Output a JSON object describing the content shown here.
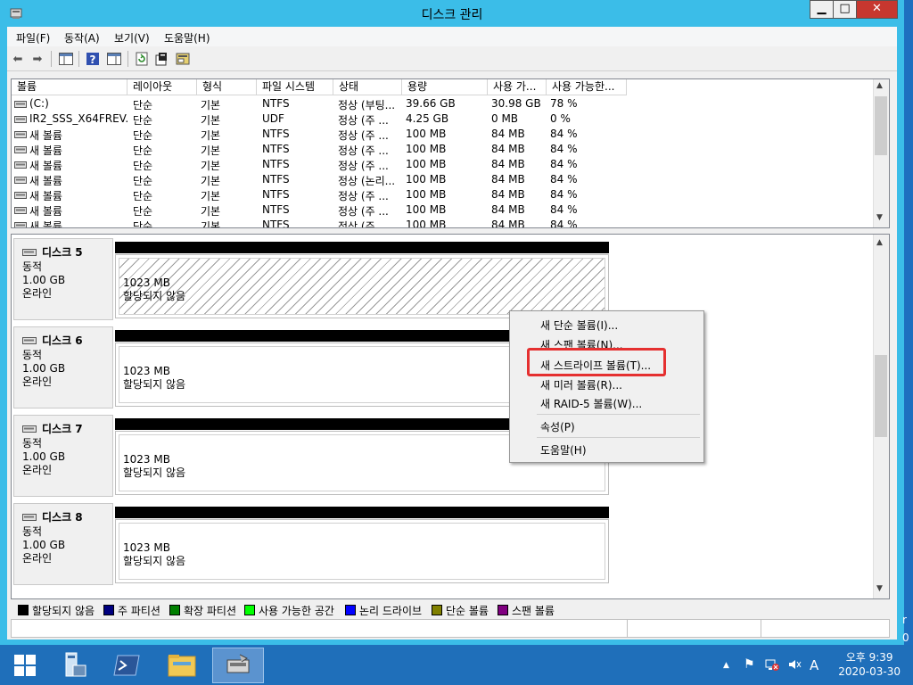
{
  "window": {
    "title": "디스크 관리",
    "minimize": "▁",
    "maximize": "□",
    "close": "✕"
  },
  "menu": [
    {
      "label": "파일(F)"
    },
    {
      "label": "동작(A)"
    },
    {
      "label": "보기(V)"
    },
    {
      "label": "도움말(H)"
    }
  ],
  "toolbar_icons": [
    "back-arrow-icon",
    "forward-arrow-icon",
    "console-tree-icon",
    "help-icon",
    "properties-pane-icon",
    "refresh-icon",
    "properties-icon",
    "disk-settings-icon"
  ],
  "volume_list": {
    "columns": [
      "볼륨",
      "레이아웃",
      "형식",
      "파일 시스템",
      "상태",
      "용량",
      "사용 가...",
      "사용 가능한..."
    ],
    "rows": [
      [
        "(C:)",
        "단순",
        "기본",
        "NTFS",
        "정상 (부팅...",
        "39.66 GB",
        "30.98 GB",
        "78 %"
      ],
      [
        "IR2_SSS_X64FREV...",
        "단순",
        "기본",
        "UDF",
        "정상 (주 ...",
        "4.25 GB",
        "0 MB",
        "0 %"
      ],
      [
        "새 볼륨",
        "단순",
        "기본",
        "NTFS",
        "정상 (주 ...",
        "100 MB",
        "84 MB",
        "84 %"
      ],
      [
        "새 볼륨",
        "단순",
        "기본",
        "NTFS",
        "정상 (주 ...",
        "100 MB",
        "84 MB",
        "84 %"
      ],
      [
        "새 볼륨",
        "단순",
        "기본",
        "NTFS",
        "정상 (주 ...",
        "100 MB",
        "84 MB",
        "84 %"
      ],
      [
        "새 볼륨",
        "단순",
        "기본",
        "NTFS",
        "정상 (논리...",
        "100 MB",
        "84 MB",
        "84 %"
      ],
      [
        "새 볼륨",
        "단순",
        "기본",
        "NTFS",
        "정상 (주 ...",
        "100 MB",
        "84 MB",
        "84 %"
      ],
      [
        "새 볼륨",
        "단순",
        "기본",
        "NTFS",
        "정상 (주 ...",
        "100 MB",
        "84 MB",
        "84 %"
      ],
      [
        "새 볼륨",
        "단순",
        "기본",
        "NTFS",
        "정상 (주 ...",
        "100 MB",
        "84 MB",
        "84 %"
      ]
    ]
  },
  "disks": [
    {
      "name": "디스크 5",
      "type": "동적",
      "size": "1.00 GB",
      "status": "온라인",
      "part_size": "1023 MB",
      "part_status": "할당되지 않음",
      "selected": true
    },
    {
      "name": "디스크 6",
      "type": "동적",
      "size": "1.00 GB",
      "status": "온라인",
      "part_size": "1023 MB",
      "part_status": "할당되지 않음",
      "selected": false
    },
    {
      "name": "디스크 7",
      "type": "동적",
      "size": "1.00 GB",
      "status": "온라인",
      "part_size": "1023 MB",
      "part_status": "할당되지 않음",
      "selected": false
    },
    {
      "name": "디스크 8",
      "type": "동적",
      "size": "1.00 GB",
      "status": "온라인",
      "part_size": "1023 MB",
      "part_status": "할당되지 않음",
      "selected": false
    }
  ],
  "legend": [
    {
      "label": "할당되지 않음",
      "color": "#000000"
    },
    {
      "label": "주 파티션",
      "color": "#00007f"
    },
    {
      "label": "확장 파티션",
      "color": "#007f00"
    },
    {
      "label": "사용 가능한 공간",
      "color": "#00ff00"
    },
    {
      "label": "논리 드라이브",
      "color": "#0000ff"
    },
    {
      "label": "단순 볼륨",
      "color": "#808000"
    },
    {
      "label": "스팬 볼륨",
      "color": "#800080"
    }
  ],
  "context_menu": {
    "items": [
      {
        "label": "새 단순 볼륨(I)..."
      },
      {
        "label": "새 스팬 볼륨(N)..."
      },
      {
        "label": "새 스트라이프 볼륨(T)...",
        "highlighted": true
      },
      {
        "label": "새 미러 볼륨(R)..."
      },
      {
        "label": "새 RAID-5 볼륨(W)..."
      },
      {
        "label": "속성(P)"
      },
      {
        "label": "도움말(H)"
      }
    ],
    "highlight_color": "#e53030"
  },
  "taskbar": {
    "apps": [
      "start-icon",
      "server-manager-icon",
      "powershell-icon",
      "file-explorer-icon",
      "disk-management-icon"
    ],
    "tray": {
      "up": "▲",
      "ime": "A"
    },
    "clock_time": "오후 9:39",
    "clock_date": "2020-03-30"
  },
  "desktop_edge_text": [
    "r",
    "0"
  ],
  "colors": {
    "window_border": "#3bbde8",
    "taskbar": "#1f6fba",
    "close_button": "#c7372f"
  }
}
